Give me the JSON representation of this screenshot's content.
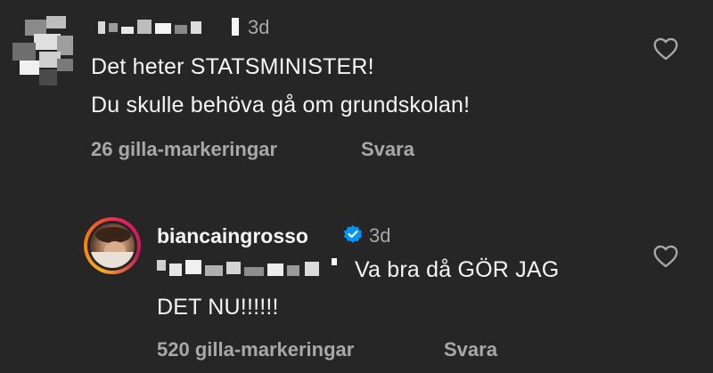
{
  "comment": {
    "time": "3d",
    "lines": [
      "Det heter STATSMINISTER!",
      "Du skulle behöva gå om grundskolan!"
    ],
    "likes": "26 gilla-markeringar",
    "reply_label": "Svara"
  },
  "reply": {
    "username": "biancaingrosso",
    "time": "3d",
    "text_line1": "Va bra då GÖR JAG",
    "text_line2": "DET NU!!!!!!",
    "likes": "520 gilla-markeringar",
    "reply_label": "Svara"
  },
  "colors": {
    "background": "#262626",
    "text": "#f5f5f5",
    "secondary": "#a8a8a8",
    "verified": "#0095f6"
  }
}
